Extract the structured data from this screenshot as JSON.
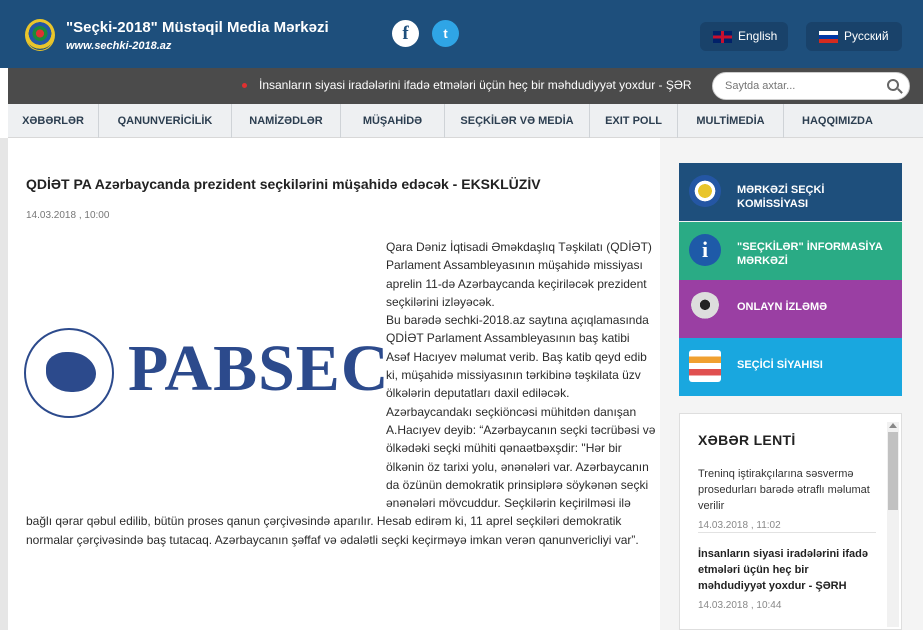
{
  "header": {
    "site_name": "\"Seçki-2018\" Müstəqil Media Mərkəzi",
    "site_url": "www.sechki-2018.az",
    "languages": [
      {
        "label": "English",
        "icon": "uk-flag-icon"
      },
      {
        "label": "Русский",
        "icon": "ru-flag-icon"
      }
    ],
    "social": {
      "facebook_glyph": "f",
      "twitter_glyph": "t"
    }
  },
  "ticker": {
    "text": "İnsanların siyasi iradələrini ifadə etmələri üçün heç bir məhdudiyyət yoxdur - ŞƏR",
    "search_placeholder": "Saytda axtar..."
  },
  "nav": {
    "items": [
      {
        "label": "XƏBƏRLƏR"
      },
      {
        "label": "QANUNVERİCİLİK"
      },
      {
        "label": "NAMİZƏDLƏR"
      },
      {
        "label": "MÜŞAHİDƏ"
      },
      {
        "label": "SEÇKİLƏR VƏ MEDİA"
      },
      {
        "label": "EXIT POLL"
      },
      {
        "label": "MULTİMEDİA"
      },
      {
        "label": "HAQQIMIZDA"
      }
    ]
  },
  "article": {
    "title": "QDİƏT PA Azərbaycanda prezident seçkilərini müşahidə edəcək - EKSKLÜZİV",
    "date": "14.03.2018 , 10:00",
    "image_logo_text": "PABSEC",
    "paragraphs": [
      "Qara Dəniz İqtisadi Əməkdaşlıq Təşkilatı (QDİƏT)  Parlament Assambleyasının müşahidə missiyası aprelin 11-də Azərbaycanda keçiriləcək prezident seçkilərini izləyəcək.",
      "Bu barədə sechki-2018.az saytına açıqlamasında QDİƏT Parlament Assambleyasının baş katibi Asəf Hacıyev məlumat verib. Baş katib qeyd edib ki, müşahidə missiyasının tərkibinə təşkilata üzv ölkələrin deputatları daxil ediləcək.",
      "Azərbaycandakı seçkiöncəsi mühitdən danışan A.Hacıyev deyib: “Azərbaycanın seçki təcrübəsi və ölkədəki seçki mühiti qənaətbəxşdir: \"Hər bir ölkənin öz tarixi yolu, ənənələri var. Azərbaycanın da özünün demokratik prinsiplərə söykənən seçki ənənələri mövcuddur. Seçkilərin keçirilməsi ilə bağlı qərar qəbul edilib, bütün proses qanun çərçivəsində aparılır. Hesab edirəm ki, 11 aprel seçkiləri demokratik normalar çərçivəsində baş tutacaq. Azərbaycanın şəffaf və ədalətli seçki keçirməyə imkan verən qanunvericliyi var”."
    ]
  },
  "sidebar": {
    "buttons": [
      {
        "label": "MƏRKƏZİ SEÇKİ KOMİSSİYASI",
        "icon": "election-commission-emblem-icon",
        "color": "#1e4f7c"
      },
      {
        "label": "\"SEÇKİLƏR\" İNFORMASİYA MƏRKƏZİ",
        "icon": "info-icon",
        "color": "#2aab85"
      },
      {
        "label": "ONLAYN İZLƏMƏ",
        "icon": "webcam-icon",
        "color": "#9a3fa3"
      },
      {
        "label": "SEÇİCİ SİYAHISI",
        "icon": "voter-list-icon",
        "color": "#19a7df"
      }
    ]
  },
  "news_feed": {
    "title": "XƏBƏR LENTİ",
    "items": [
      {
        "headline": "Treninq iştirakçılarına səsvermə prosedurları barədə ətraflı məlumat verilir",
        "date": "14.03.2018 , 11:02"
      },
      {
        "headline": "İnsanların siyasi iradələrini ifadə etmələri üçün heç bir məhdudiyyət yoxdur - ŞƏRH",
        "date": "14.03.2018 , 10:44"
      }
    ]
  }
}
